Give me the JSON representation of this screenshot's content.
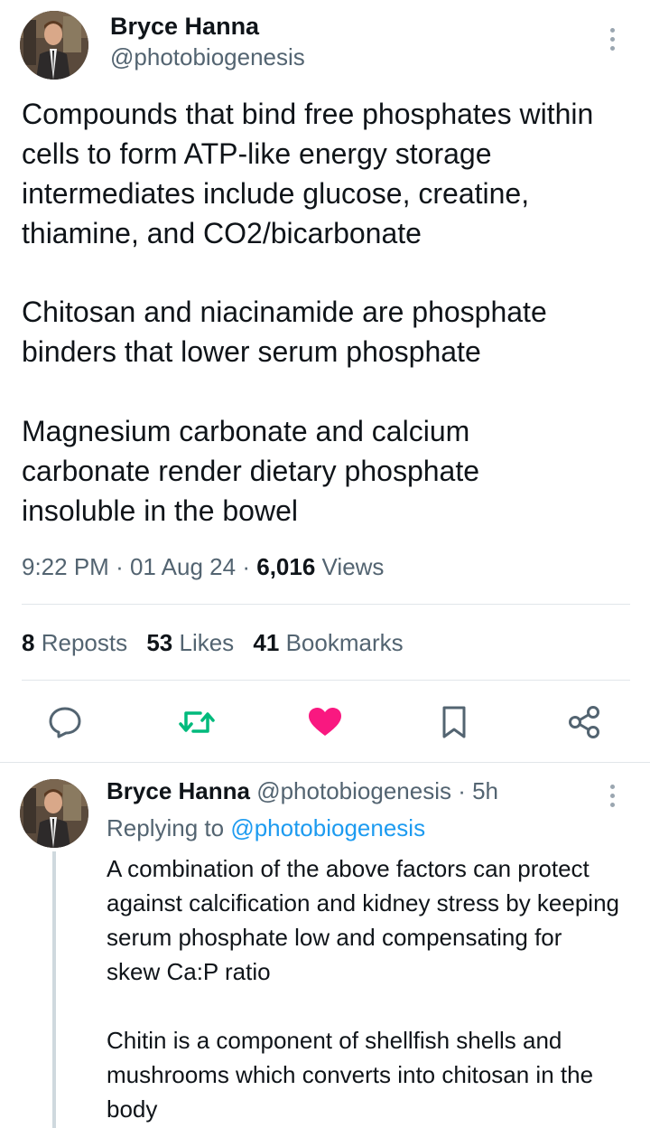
{
  "main_tweet": {
    "author_name": "Bryce Hanna",
    "author_handle": "@photobiogenesis",
    "paragraphs": [
      "Compounds that bind free phosphates within cells to form ATP-like energy storage intermediates include glucose, creatine, thiamine, and CO2/bicarbonate",
      "Chitosan and niacinamide are phosphate binders that lower serum phosphate",
      "Magnesium carbonate and calcium carbonate render dietary phosphate insoluble in the bowel"
    ],
    "time": "9:22 PM",
    "date": "01 Aug 24",
    "sep": "·",
    "views_count": "6,016",
    "views_label": "Views",
    "reposts_count": "8",
    "reposts_label": "Reposts",
    "likes_count": "53",
    "likes_label": "Likes",
    "bookmarks_count": "41",
    "bookmarks_label": "Bookmarks",
    "actions": [
      "reply-icon",
      "repost-icon",
      "like-icon",
      "bookmark-icon",
      "share-icon"
    ]
  },
  "reply_tweet": {
    "author_name": "Bryce Hanna",
    "author_handle": "@photobiogenesis",
    "age": "· 5h",
    "replying_prefix": "Replying to",
    "replying_handle": "@photobiogenesis",
    "paragraphs": [
      "A combination of the above factors can protect against calcification and kidney stress by keeping serum phosphate low and compensating for skew Ca:P ratio",
      "Chitin is a component of shellfish shells and mushrooms which converts into chitosan in the body"
    ]
  },
  "colors": {
    "like_active": "#f91880",
    "repost_green": "#00ba7c",
    "link_blue": "#1d9bf0",
    "muted_gray": "#536471"
  }
}
